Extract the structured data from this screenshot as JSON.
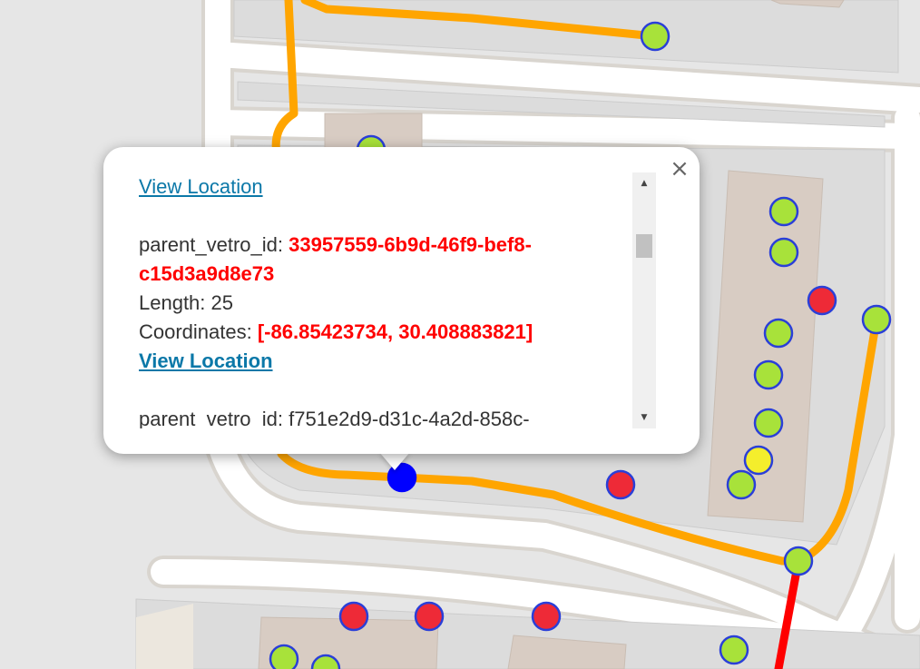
{
  "map": {
    "colors": {
      "background": "#e6e6e6",
      "road": "#ffffff",
      "road_edge": "#d9d5cf",
      "block": "#dedede",
      "building": "#d8ccc3",
      "fiber_route": "#ffa500",
      "fiber_route_alt": "#ff0000",
      "node_green": "#a8e23a",
      "node_red": "#ee2a37",
      "node_yellow": "#f4ee2c",
      "node_selected": "#0000ff",
      "node_outline": "#2a3fd8"
    }
  },
  "popup": {
    "close_icon": "close-icon",
    "entries": [
      {
        "link": "View Location"
      },
      {
        "id_label": "parent_vetro_id: ",
        "id_value": "33957559-6b9d-46f9-bef8-c15d3a9d8e73",
        "length_label": "Length: ",
        "length_value": "25",
        "coords_label": "Coordinates: ",
        "coords_value": "[-86.85423734, 30.408883821]",
        "link": "View Location"
      },
      {
        "id_label": "parent_vetro_id: ",
        "id_value": "f751e2d9-d31c-4a2d-858c-"
      }
    ],
    "scrollbar": {
      "up_icon": "arrow-up-icon",
      "down_icon": "arrow-down-icon"
    }
  }
}
